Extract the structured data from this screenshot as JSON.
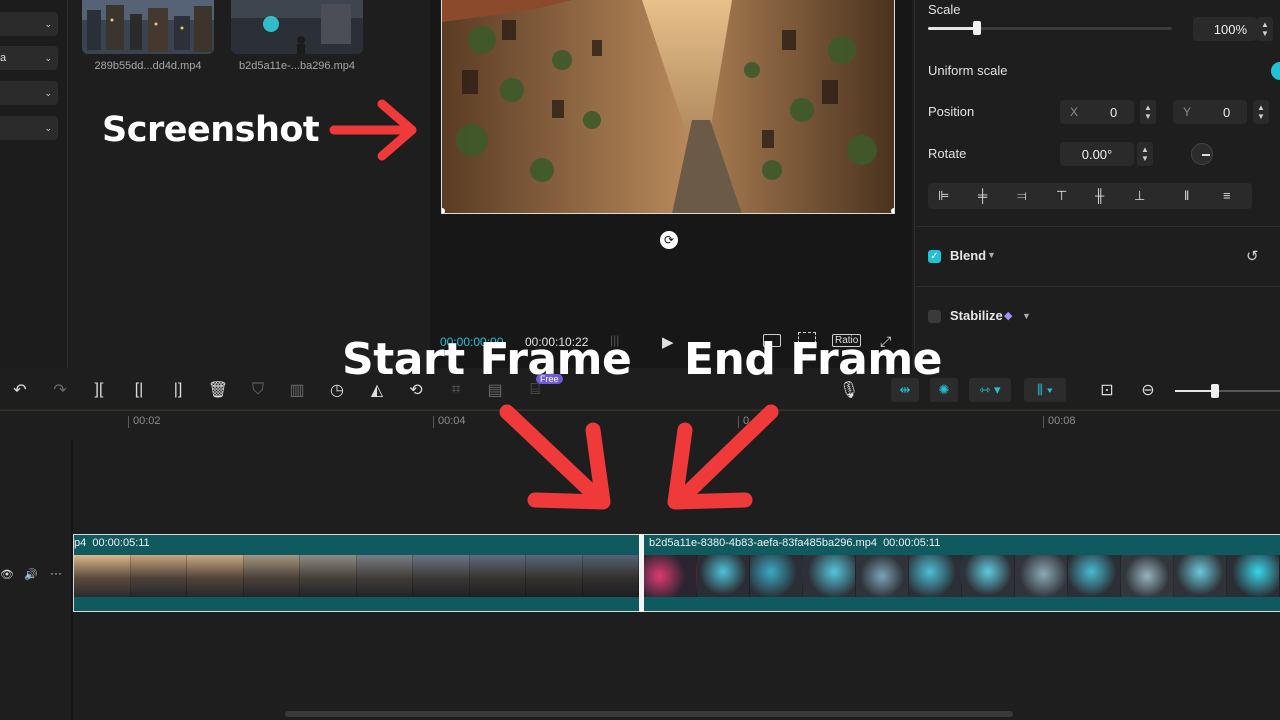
{
  "sidebar": {
    "dropdowns": [
      {
        "label": ""
      },
      {
        "label": "a"
      },
      {
        "label": ""
      },
      {
        "label": ""
      }
    ]
  },
  "media": {
    "items": [
      {
        "name": "289b55dd...dd4d.mp4"
      },
      {
        "name": "b2d5a11e-...ba296.mp4"
      }
    ]
  },
  "preview": {
    "current_time": "00:00:00:00",
    "total_time": "00:00:10:22",
    "ratio_label": "Ratio"
  },
  "properties": {
    "scale_label": "Scale",
    "scale_value": "100%",
    "scale_slider_fraction": 0.2,
    "uniform_scale_label": "Uniform scale",
    "uniform_scale_on": true,
    "position_label": "Position",
    "x_label": "X",
    "x_value": "0",
    "y_label": "Y",
    "y_value": "0",
    "rotate_label": "Rotate",
    "rotate_value": "0.00°",
    "blend_label": "Blend",
    "blend_checked": true,
    "stabilize_label": "Stabilize",
    "stabilize_checked": false
  },
  "toolbar": {
    "free_badge": "Free",
    "zoom_fraction": 0.38
  },
  "ruler": {
    "ticks": [
      "00:02",
      "00:04",
      "0",
      "00:08"
    ]
  },
  "timeline": {
    "clip1": {
      "name": "p4",
      "duration": "00:00:05:11"
    },
    "clip2": {
      "name": "b2d5a11e-8380-4b83-aefa-83fa485ba296.mp4",
      "duration": "00:00:05:11"
    }
  },
  "annotations": {
    "screenshot": "Screenshot",
    "start_frame": "Start Frame",
    "end_frame": "End Frame"
  },
  "colors": {
    "accent": "#21c1d6",
    "clip_bg": "#0f5a5e",
    "arrow": "#f03a3a"
  }
}
